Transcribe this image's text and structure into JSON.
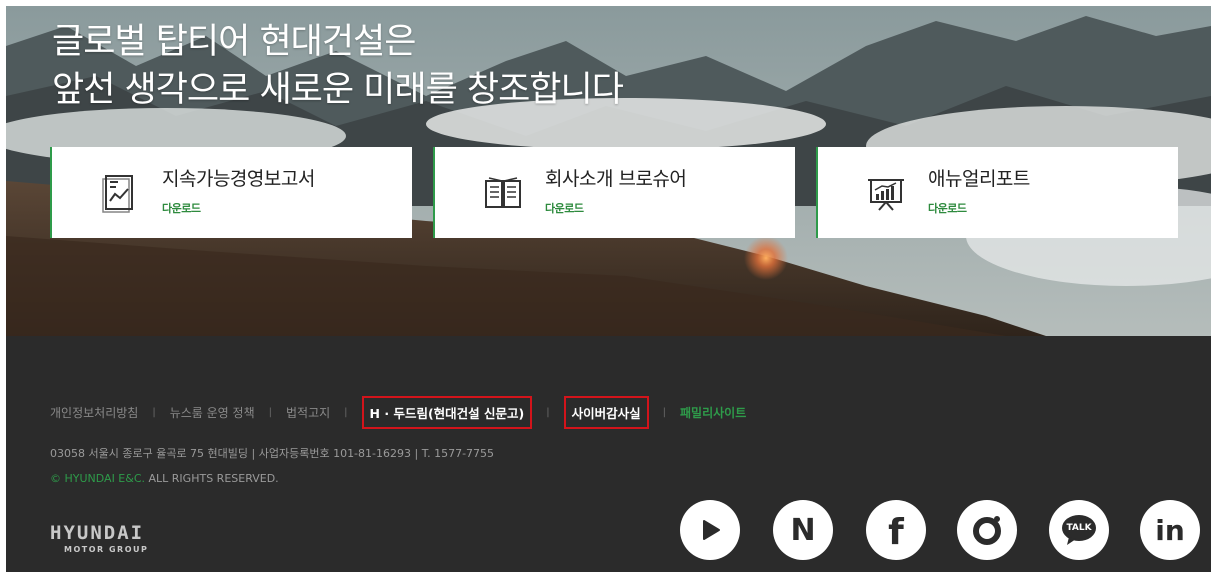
{
  "hero": {
    "headline_line1": "글로벌 탑티어 현대건설은",
    "headline_line2": "앞선 생각으로 새로운 미래를 창조합니다"
  },
  "cards": [
    {
      "title": "지속가능경영보고서",
      "action": "다운로드",
      "icon": "report-chart-icon"
    },
    {
      "title": "회사소개 브로슈어",
      "action": "다운로드",
      "icon": "open-book-icon"
    },
    {
      "title": "애뉴얼리포트",
      "action": "다운로드",
      "icon": "presentation-board-icon"
    }
  ],
  "footer": {
    "links": [
      {
        "label": "개인정보처리방침",
        "highlighted": false
      },
      {
        "label": "뉴스룸 운영 정책",
        "highlighted": false
      },
      {
        "label": "법적고지",
        "highlighted": false
      },
      {
        "label": "H · 두드림(현대건설 신문고)",
        "highlighted": true
      },
      {
        "label": "사이버감사실",
        "highlighted": true
      },
      {
        "label": "패밀리사이트",
        "highlighted": false
      }
    ],
    "address": "03058 서울시 종로구 율곡로 75 현대빌딩 | 사업자등록번호 101-81-16293 | T. 1577-7755",
    "copyright_brand": "© HYUNDAI E&C.",
    "copyright_rest": " ALL RIGHTS RESERVED.",
    "logo_main": "HYUNDAI",
    "logo_sub": "MOTOR GROUP",
    "social": [
      {
        "name": "youtube-icon",
        "label": ""
      },
      {
        "name": "naver-blog-icon",
        "label": "N"
      },
      {
        "name": "facebook-icon",
        "label": "f"
      },
      {
        "name": "instagram-icon",
        "label": ""
      },
      {
        "name": "kakao-talk-icon",
        "label": "TALK"
      },
      {
        "name": "linkedin-icon",
        "label": "in"
      }
    ]
  },
  "colors": {
    "accent_green": "#2e9b4a",
    "highlight_red": "#d3141b",
    "footer_bg": "#2b2b2b"
  }
}
